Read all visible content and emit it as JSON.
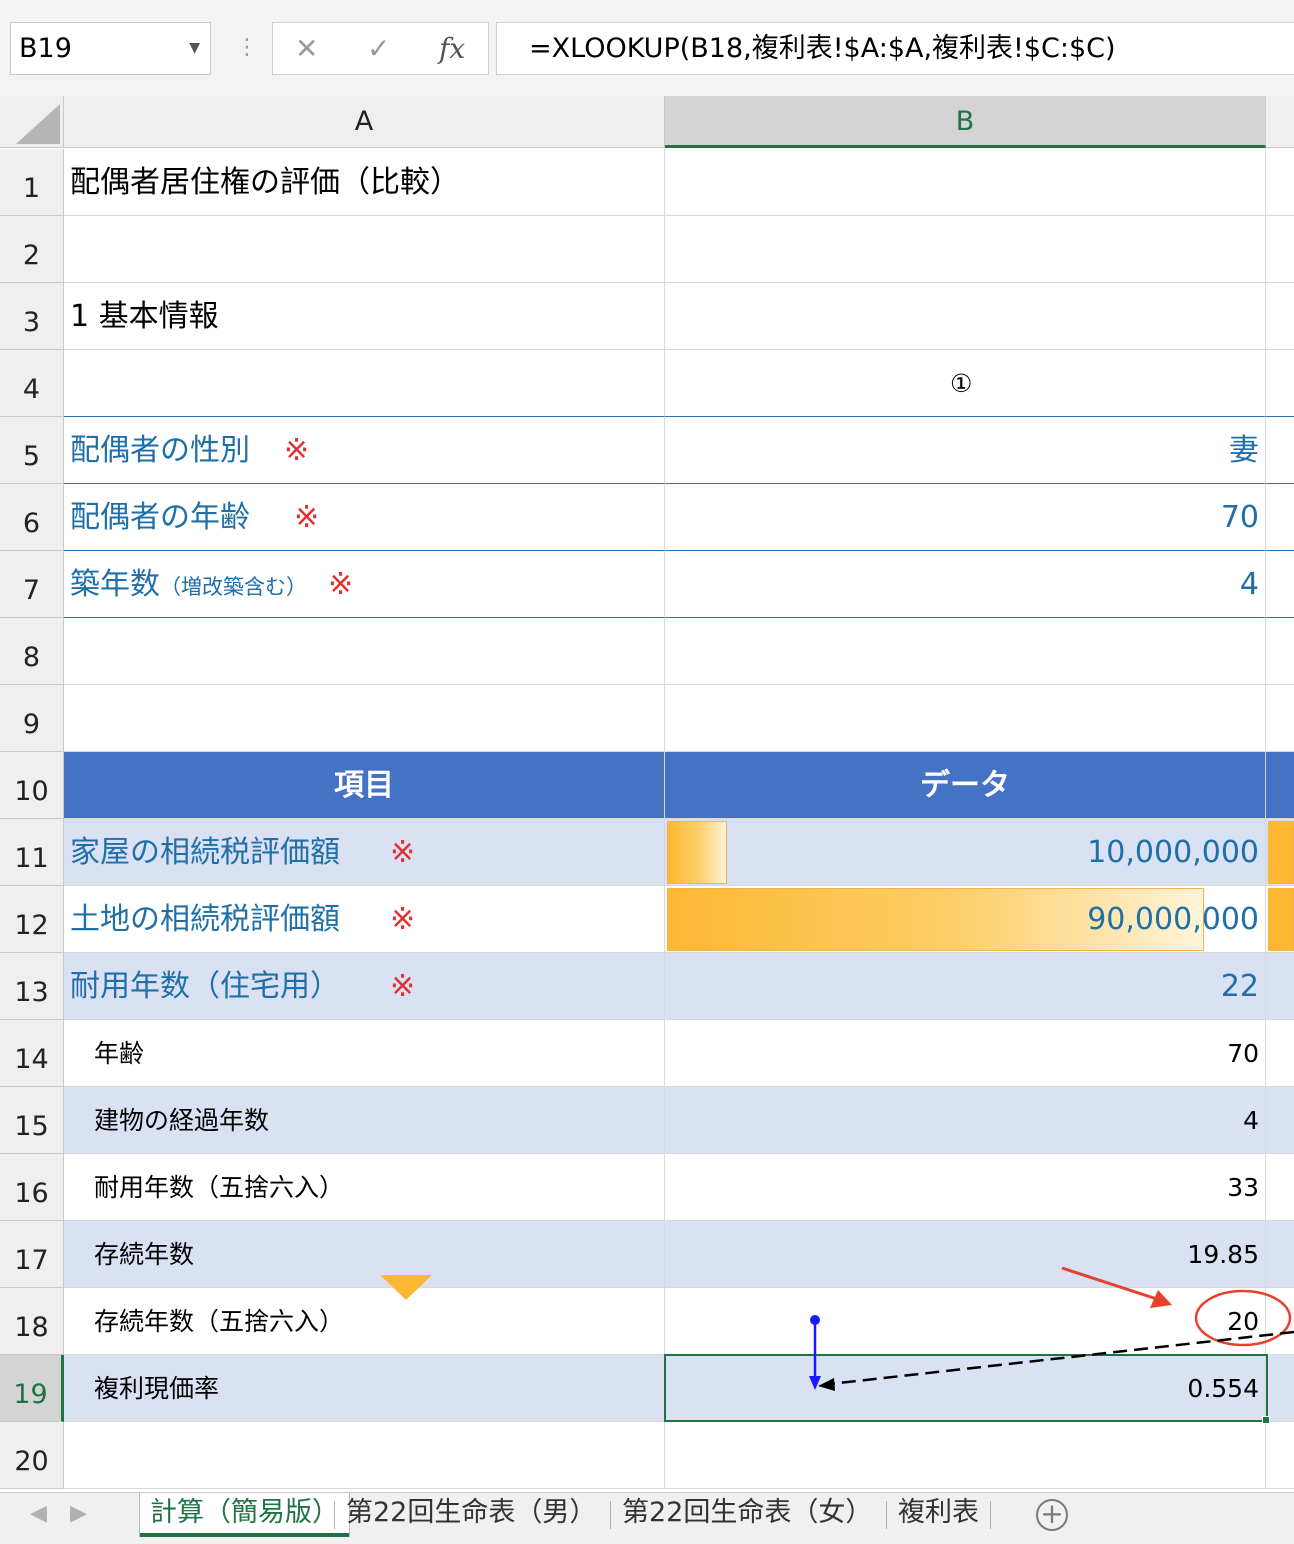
{
  "formula_bar": {
    "name_box": "B19",
    "cancel_icon": "close-icon",
    "enter_icon": "check-icon",
    "fx_label": "fx",
    "formula": "=XLOOKUP(B18,複利表!$A:$A,複利表!$C:$C)"
  },
  "columns": [
    "A",
    "B"
  ],
  "rows": [
    {
      "n": "1",
      "a": "配偶者居住権の評価（比較）",
      "b": ""
    },
    {
      "n": "2",
      "a": "",
      "b": ""
    },
    {
      "n": "3",
      "a": "1 基本情報",
      "b": ""
    },
    {
      "n": "4",
      "a": "",
      "b": "①"
    },
    {
      "n": "5",
      "a": "配偶者の性別",
      "mark": "※",
      "b": "妻"
    },
    {
      "n": "6",
      "a": "配偶者の年齢",
      "mark": "※",
      "b": "70"
    },
    {
      "n": "7",
      "a": "築年数",
      "a_small": "（増改築含む）",
      "mark": "※",
      "b": "4"
    },
    {
      "n": "8",
      "a": "",
      "b": ""
    },
    {
      "n": "9",
      "a": "",
      "b": ""
    },
    {
      "n": "10",
      "a": "項目",
      "b": "データ"
    },
    {
      "n": "11",
      "a": "家屋の相続税評価額",
      "mark": "※",
      "b": "10,000,000"
    },
    {
      "n": "12",
      "a": "土地の相続税評価額",
      "mark": "※",
      "b": "90,000,000"
    },
    {
      "n": "13",
      "a": "耐用年数（住宅用）",
      "mark": "※",
      "b": "22"
    },
    {
      "n": "14",
      "a": "年齢",
      "b": "70"
    },
    {
      "n": "15",
      "a": "建物の経過年数",
      "b": "4"
    },
    {
      "n": "16",
      "a": "耐用年数（五捨六入）",
      "b": "33"
    },
    {
      "n": "17",
      "a": "存続年数",
      "b": "19.85"
    },
    {
      "n": "18",
      "a": "存続年数（五捨六入）",
      "b": "20"
    },
    {
      "n": "19",
      "a": "複利現価率",
      "b": "0.554"
    },
    {
      "n": "20",
      "a": "",
      "b": ""
    }
  ],
  "data_bars": {
    "row11_fraction": 0.1111,
    "row12_fraction": 1.0
  },
  "sheet_tabs": [
    "計算（簡易版）",
    "第22回生命表（男）",
    "第22回生命表（女）",
    "複利表"
  ],
  "active_tab": "計算（簡易版）",
  "colors": {
    "accent": "#217346",
    "header_fill": "#4472c4",
    "band_fill": "#dae1f2",
    "label_blue": "#1f6fa8",
    "mark_red": "#e03131",
    "bar_orange": "#fdb733",
    "annotation_red": "#e8402a",
    "trace_blue": "#1a1aff"
  }
}
